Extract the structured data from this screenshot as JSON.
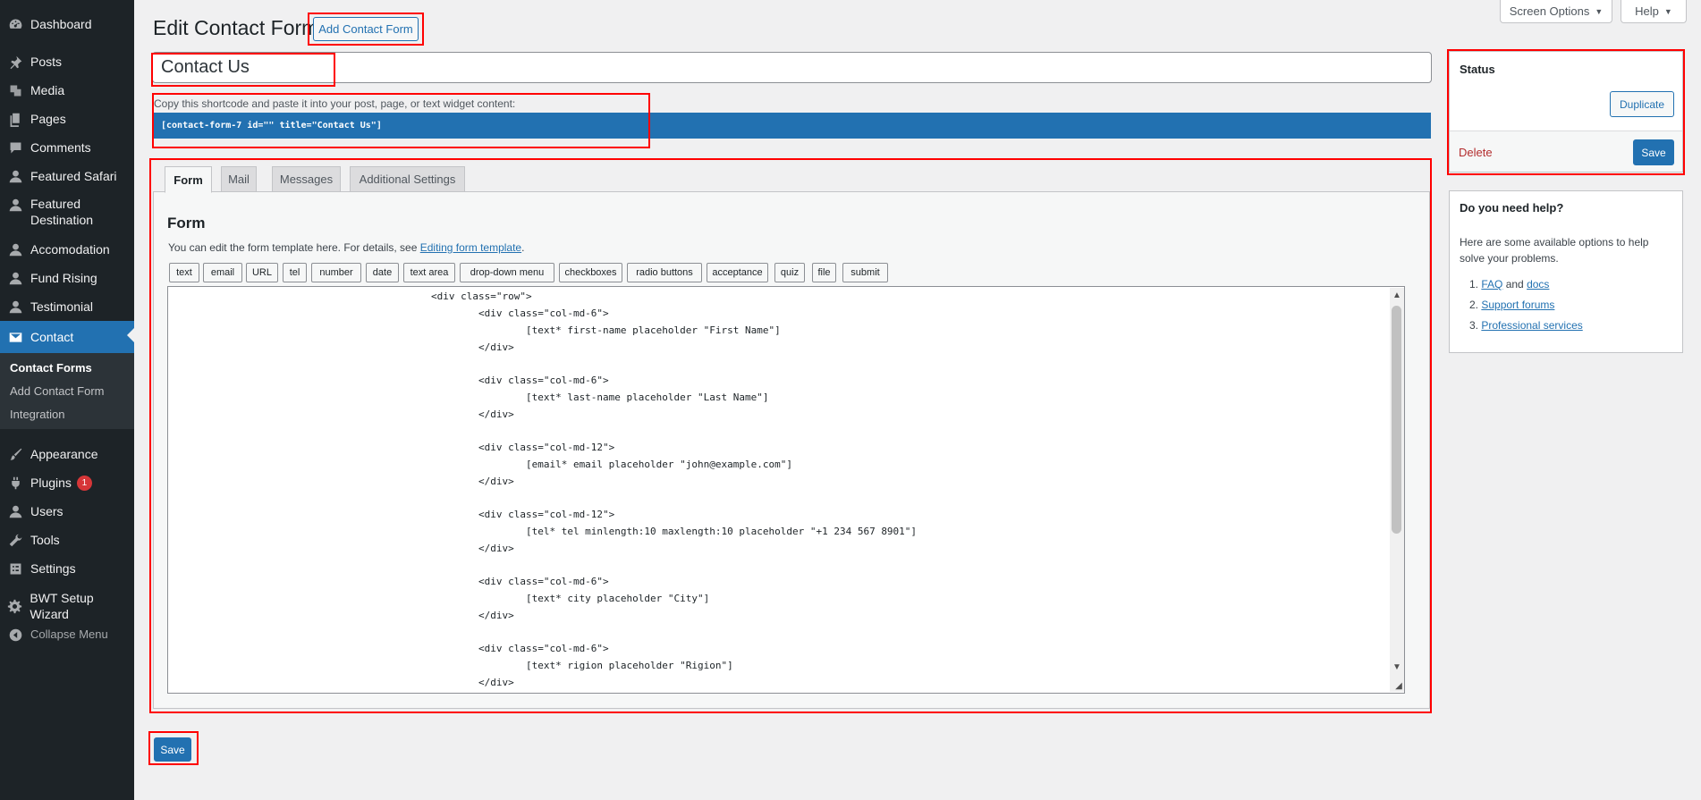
{
  "sidebar": {
    "items": [
      {
        "label": "Dashboard",
        "icon": "dashboard-icon"
      },
      {
        "label": "Posts",
        "icon": "pin-icon"
      },
      {
        "label": "Media",
        "icon": "media-icon"
      },
      {
        "label": "Pages",
        "icon": "pages-icon"
      },
      {
        "label": "Comments",
        "icon": "comments-icon"
      },
      {
        "label": "Featured Safari",
        "icon": "user-icon"
      },
      {
        "label": "Featured Destination",
        "icon": "user-icon"
      },
      {
        "label": "Accomodation",
        "icon": "user-icon"
      },
      {
        "label": "Fund Rising",
        "icon": "user-icon"
      },
      {
        "label": "Testimonial",
        "icon": "user-icon"
      },
      {
        "label": "Contact",
        "icon": "mail-icon"
      },
      {
        "label": "Appearance",
        "icon": "brush-icon"
      },
      {
        "label": "Plugins",
        "icon": "plugin-icon",
        "badge": "1"
      },
      {
        "label": "Users",
        "icon": "users-icon"
      },
      {
        "label": "Tools",
        "icon": "wrench-icon"
      },
      {
        "label": "Settings",
        "icon": "settings-icon"
      },
      {
        "label": "BWT Setup Wizard",
        "icon": "gear-icon"
      }
    ],
    "submenu": [
      "Contact Forms",
      "Add Contact Form",
      "Integration"
    ],
    "collapse_label": "Collapse Menu"
  },
  "top": {
    "screen_options": "Screen Options",
    "help": "Help"
  },
  "header": {
    "title": "Edit Contact Form",
    "add_new": "Add Contact Form"
  },
  "form": {
    "title_value": "Contact Us",
    "shortcode_label": "Copy this shortcode and paste it into your post, page, or text widget content:",
    "shortcode": "[contact-form-7 id=\"\" title=\"Contact Us\"]"
  },
  "tabs": [
    "Form",
    "Mail",
    "Messages",
    "Additional Settings"
  ],
  "panel": {
    "heading": "Form",
    "desc_prefix": "You can edit the form template here. For details, see ",
    "desc_link": "Editing form template",
    "desc_suffix": "."
  },
  "tag_buttons": [
    "text",
    "email",
    "URL",
    "tel",
    "number",
    "date",
    "text area",
    "drop-down menu",
    "checkboxes",
    "radio buttons",
    "acceptance",
    "quiz",
    "file",
    "submit"
  ],
  "code_lines": [
    "<div class=\"row\">",
    "        <div class=\"col-md-6\">",
    "                [text* first-name placeholder \"First Name\"]",
    "        </div>",
    "",
    "        <div class=\"col-md-6\">",
    "                [text* last-name placeholder \"Last Name\"]",
    "        </div>",
    "",
    "        <div class=\"col-md-12\">",
    "                [email* email placeholder \"john@example.com\"]",
    "        </div>",
    "",
    "        <div class=\"col-md-12\">",
    "                [tel* tel minlength:10 maxlength:10 placeholder \"+1 234 567 8901\"]",
    "        </div>",
    "",
    "        <div class=\"col-md-6\">",
    "                [text* city placeholder \"City\"]",
    "        </div>",
    "",
    "        <div class=\"col-md-6\">",
    "                [text* rigion placeholder \"Rigion\"]",
    "        </div>"
  ],
  "status_box": {
    "title": "Status",
    "duplicate": "Duplicate",
    "delete": "Delete",
    "save": "Save"
  },
  "help_box": {
    "title": "Do you need help?",
    "text": "Here are some available options to help solve your problems.",
    "items": [
      {
        "num": "1.",
        "link1": "FAQ",
        "mid": " and ",
        "link2": "docs"
      },
      {
        "num": "2.",
        "link1": "Support forums"
      },
      {
        "num": "3.",
        "link1": "Professional services"
      }
    ]
  },
  "bottom_save": "Save",
  "colors": {
    "sidebar_bg": "#1d2327",
    "accent": "#2271b1",
    "highlight": "#ff0000",
    "delete": "#b32d2e",
    "badge": "#d63638"
  }
}
